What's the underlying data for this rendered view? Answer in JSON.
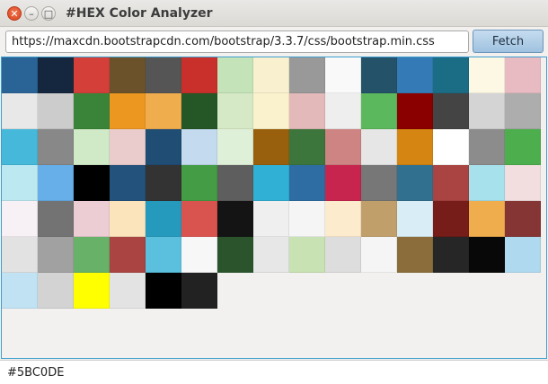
{
  "window": {
    "title": "#HEX Color Analyzer",
    "close_glyph": "✕",
    "minimize_glyph": "–",
    "maximize_glyph": "□"
  },
  "toolbar": {
    "url_value": "https://maxcdn.bootstrapcdn.com/bootstrap/3.3.7/css/bootstrap.min.css",
    "fetch_label": "Fetch"
  },
  "palette": {
    "colors": [
      "#2a6496",
      "#15273e",
      "#d43f3a",
      "#6b522b",
      "#555555",
      "#c9302c",
      "#c4e3b8",
      "#f8f0cf",
      "#999999",
      "#f9f9f9",
      "#245269",
      "#337ab7",
      "#1b6d85",
      "#fcf8e3",
      "#e8bbc3",
      "#e8e8e8",
      "#cccccc",
      "#398439",
      "#ec971f",
      "#f0ad4e",
      "#255625",
      "#d6e9c6",
      "#faf2cc",
      "#e4b9b9",
      "#eeeeee",
      "#5cb85c",
      "#8a0000",
      "#444444",
      "#d4d4d4",
      "#adadad",
      "#46b8da",
      "#888888",
      "#d0e9c6",
      "#ebcccc",
      "#204d74",
      "#c4daef",
      "#dff0d8",
      "#985f0d",
      "#3c763d",
      "#ce8483",
      "#e6e6e6",
      "#d58512",
      "#ffffff",
      "#8c8c8c",
      "#4cae4c",
      "#bce8f1",
      "#66afe9",
      "#000000",
      "#23527c",
      "#333333",
      "#449d44",
      "#5e5e5e",
      "#31b0d5",
      "#2e6da4",
      "#c7254e",
      "#777777",
      "#31708f",
      "#a94442",
      "#a6e1ec",
      "#f2dede",
      "#f7f0f5",
      "#737373",
      "#ebcdd3",
      "#fbe4bc",
      "#269abc",
      "#d9534f",
      "#141414",
      "#efefef",
      "#f5f5f5",
      "#fcebcd",
      "#c09f6b",
      "#d9edf7",
      "#761c19",
      "#f0ad4e",
      "#843534",
      "#e2e2e2",
      "#a1a1a1",
      "#67b168",
      "#a94442",
      "#5bc0de",
      "#f7f7f7",
      "#2b542c",
      "#e7e7e7",
      "#c9e2b3",
      "#dddddd",
      "#f5f5f5",
      "#8a6d3b",
      "#262626",
      "#080808",
      "#afd9ee",
      "#c1e2f3",
      "#d3d3d3",
      "#ffff00",
      "#e3e3e3",
      "#000000",
      "#222222"
    ]
  },
  "status": {
    "selected_hex": "#5BC0DE"
  }
}
